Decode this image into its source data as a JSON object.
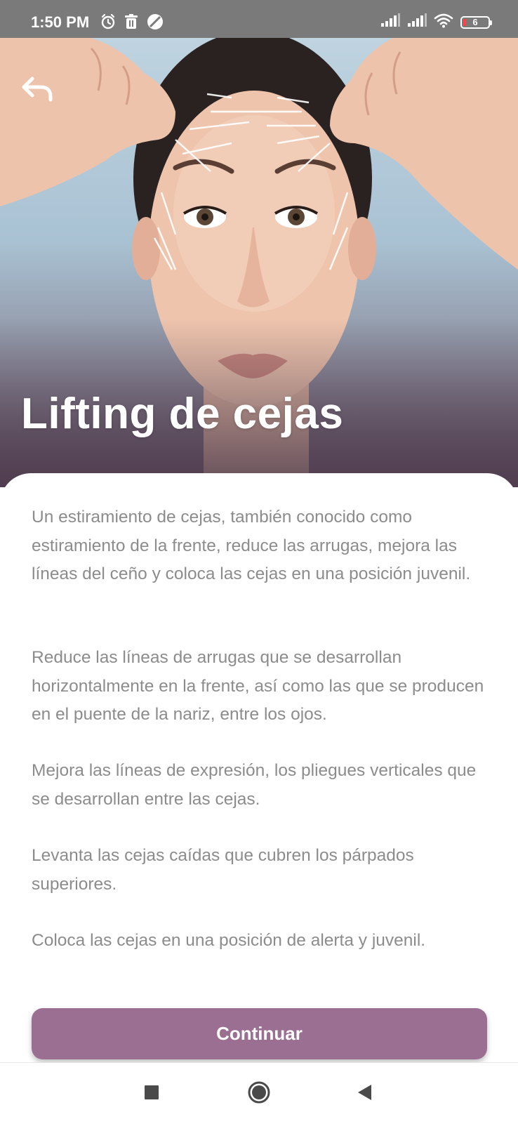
{
  "status_bar": {
    "time": "1:50 PM",
    "battery_level": "6"
  },
  "hero": {
    "title": "Lifting de cejas"
  },
  "content": {
    "paragraphs": [
      "Un estiramiento de cejas, también conocido como estiramiento de la frente, reduce las arrugas, mejora las líneas del ceño y coloca las cejas en una posición juvenil.",
      "Reduce las líneas de arrugas que se desarrollan horizontalmente en la frente, así como las que se producen en el puente de la nariz, entre los ojos.",
      "Mejora las líneas de expresión, los pliegues verticales que se desarrollan entre las cejas.",
      "Levanta las cejas caídas que cubren los párpados superiores.",
      "Coloca las cejas en una posición de alerta y juvenil."
    ]
  },
  "actions": {
    "continue_label": "Continuar"
  },
  "colors": {
    "accent": "#9b6f92",
    "status_bar": "#7a7a7a",
    "body_text": "#8c8c8c"
  },
  "icons": {
    "status_left": [
      "alarm-icon",
      "trash-icon",
      "no-disturb-icon"
    ],
    "status_right": [
      "signal-icon",
      "signal-icon",
      "wifi-icon",
      "battery-icon"
    ],
    "back": "back-arrow-icon",
    "nav": [
      "recents-icon",
      "home-icon",
      "nav-back-icon"
    ]
  }
}
